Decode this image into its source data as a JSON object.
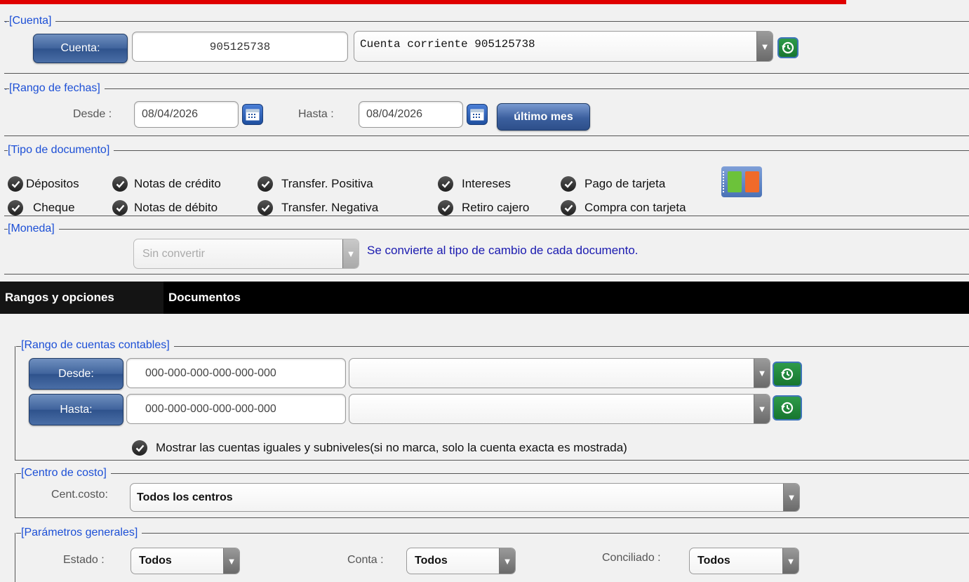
{
  "cuenta": {
    "legend": "[Cuenta]",
    "button_label": "Cuenta:",
    "number_value": "905125738",
    "select_value": "Cuenta corriente 905125738"
  },
  "fechas": {
    "legend": "[Rango de fechas]",
    "desde_label": "Desde :",
    "desde_value": "08/04/2026",
    "hasta_label": "Hasta :",
    "hasta_value": "08/04/2026",
    "ultimo_mes_label": "último mes"
  },
  "tipo_documento": {
    "legend": "[Tipo de documento]",
    "items": [
      {
        "label": "Dépositos",
        "checked": true
      },
      {
        "label": "Notas de crédito",
        "checked": true
      },
      {
        "label": "Transfer. Positiva",
        "checked": true
      },
      {
        "label": "Intereses",
        "checked": true
      },
      {
        "label": "Pago de tarjeta",
        "checked": true
      },
      {
        "label": "Cheque",
        "checked": true
      },
      {
        "label": "Notas de débito",
        "checked": true
      },
      {
        "label": "Transfer. Negativa",
        "checked": true
      },
      {
        "label": "Retiro cajero",
        "checked": true
      },
      {
        "label": "Compra con tarjeta",
        "checked": true
      }
    ]
  },
  "moneda": {
    "legend": "[Moneda]",
    "select_value": "Sin convertir",
    "note": "Se convierte al tipo de cambio de cada documento."
  },
  "tabs": [
    {
      "label": "Rangos y opciones",
      "active": true
    },
    {
      "label": "Documentos",
      "active": false
    }
  ],
  "rango_cuentas": {
    "legend": "[Rango de cuentas contables]",
    "desde_button": "Desde:",
    "desde_value": "000-000-000-000-000-000",
    "hasta_button": "Hasta:",
    "hasta_value": "000-000-000-000-000-000",
    "subniveles_label": "Mostrar las cuentas iguales y subniveles(si no marca, solo la cuenta exacta es mostrada)",
    "subniveles_checked": true
  },
  "centro_costo": {
    "legend": "[Centro de costo]",
    "label": "Cent.costo:",
    "select_value": "Todos los centros"
  },
  "parametros": {
    "legend": "[Parámetros generales]",
    "estado_label": "Estado :",
    "estado_value": "Todos",
    "conta_label": "Conta :",
    "conta_value": "Todos",
    "conciliado_label": "Conciliado :",
    "conciliado_value": "Todos"
  },
  "colors": {
    "accent_red": "#e00000",
    "legend_blue": "#1c4fd6",
    "button_blue": "#3f639c",
    "refresh_green": "#17762f"
  }
}
